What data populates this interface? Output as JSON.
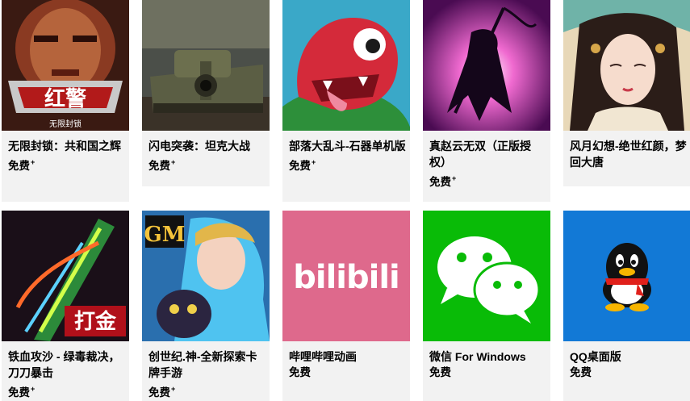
{
  "rows": [
    [
      {
        "title": "无限封锁：共和国之辉",
        "price": "免费",
        "plus": "+",
        "tile_text": "红警",
        "tile_sub": "无限封锁"
      },
      {
        "title": "闪电突袭：坦克大战",
        "price": "免费",
        "plus": "+"
      },
      {
        "title": "部落大乱斗-石器单机版",
        "price": "免费",
        "plus": "+"
      },
      {
        "title": "真赵云无双（正版授权）",
        "price": "免费",
        "plus": "+"
      },
      {
        "title": "风月幻想-绝世红颜，梦回大唐",
        "price": "",
        "plus": ""
      }
    ],
    [
      {
        "title": "铁血攻沙 - 绿毒裁决，刀刀暴击",
        "price": "免费",
        "plus": "+",
        "tile_text": "打金"
      },
      {
        "title": "创世纪.神-全新探索卡牌手游",
        "price": "免费",
        "plus": "+",
        "tile_text": "GM"
      },
      {
        "title": "哔哩哔哩动画",
        "price": "免费",
        "plus": "",
        "tile_text": "bilibili"
      },
      {
        "title": "微信 For Windows",
        "price": "免费",
        "plus": ""
      },
      {
        "title": "QQ桌面版",
        "price": "免费",
        "plus": ""
      }
    ]
  ],
  "colors": {
    "card_bg": "#f2f2f2",
    "bilibili": "#de698c",
    "wechat": "#09bb07",
    "qq": "#1279d6"
  }
}
